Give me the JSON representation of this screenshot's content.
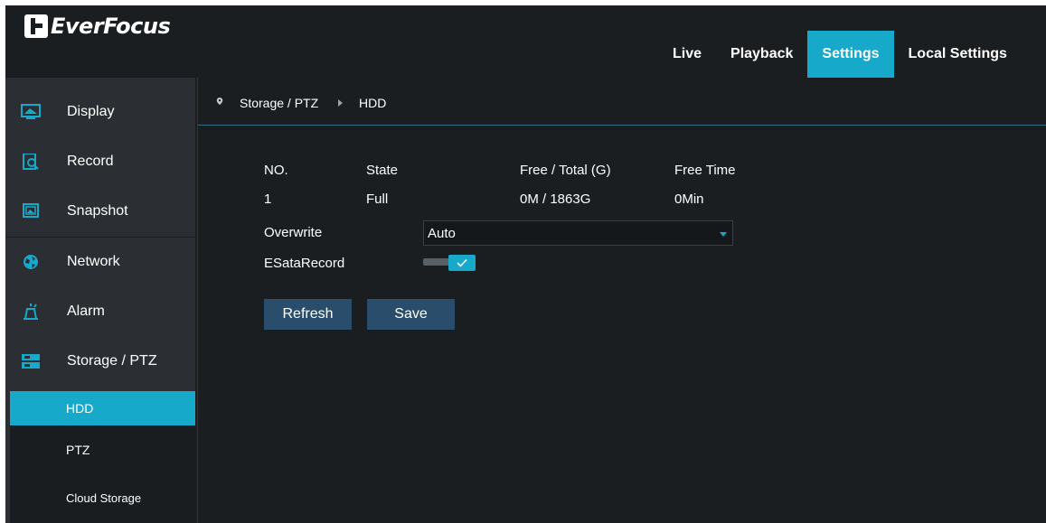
{
  "brand": {
    "name": "EverFocus"
  },
  "topnav": {
    "tabs": [
      {
        "label": "Live",
        "active": false
      },
      {
        "label": "Playback",
        "active": false
      },
      {
        "label": "Settings",
        "active": true
      },
      {
        "label": "Local Settings",
        "active": false
      }
    ]
  },
  "sidebar": {
    "items": [
      {
        "label": "Display",
        "icon": "display-icon"
      },
      {
        "label": "Record",
        "icon": "record-icon"
      },
      {
        "label": "Snapshot",
        "icon": "snapshot-icon"
      },
      {
        "label": "Network",
        "icon": "network-icon"
      },
      {
        "label": "Alarm",
        "icon": "alarm-icon"
      },
      {
        "label": "Storage / PTZ",
        "icon": "storage-icon"
      }
    ],
    "subitems": [
      {
        "label": "HDD",
        "active": true
      },
      {
        "label": "PTZ",
        "active": false
      },
      {
        "label": "Cloud Storage",
        "active": false
      }
    ]
  },
  "breadcrumb": {
    "section": "Storage / PTZ",
    "page": "HDD"
  },
  "hdd_table": {
    "headers": [
      "NO.",
      "State",
      "Free / Total (G)",
      "Free Time"
    ],
    "rows": [
      [
        "1",
        "Full",
        "0M / 1863G",
        "0Min"
      ]
    ]
  },
  "form": {
    "overwrite_label": "Overwrite",
    "overwrite_value": "Auto",
    "esata_label": "ESataRecord",
    "esata_enabled": true
  },
  "buttons": {
    "refresh": "Refresh",
    "save": "Save"
  },
  "colors": {
    "accent": "#16a9c9",
    "button": "#2a4d6b",
    "background": "#1b1e21",
    "sidebar": "#2b2f33"
  }
}
